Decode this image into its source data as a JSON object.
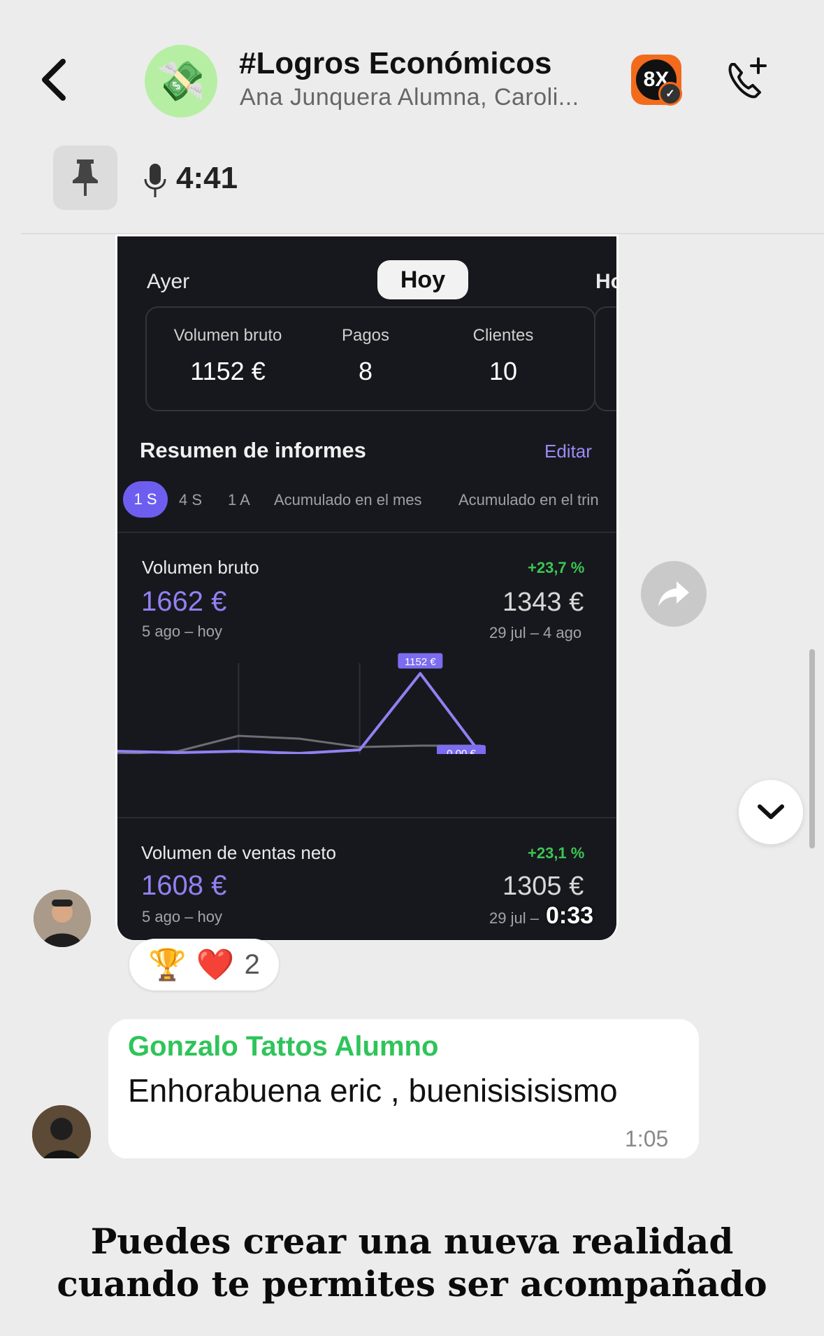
{
  "header": {
    "back_icon": "chevron-left-icon",
    "group_avatar_icon": "money-with-wings-icon",
    "title": "#Logros Económicos",
    "subtitle": "Ana Junquera Alumna, Caroli...",
    "badge_label": "8X",
    "call_icon": "phone-plus-icon"
  },
  "pinned": {
    "pin_icon": "pin-icon",
    "mic_icon": "microphone-icon",
    "duration": "4:41"
  },
  "video": {
    "segments": {
      "prev": "Ayer",
      "current": "Hoy",
      "next": "Ho"
    },
    "stats": [
      {
        "label": "Volumen bruto",
        "value": "1152 €"
      },
      {
        "label": "Pagos",
        "value": "8"
      },
      {
        "label": "Clientes",
        "value": "10"
      }
    ],
    "section_title": "Resumen de informes",
    "edit_label": "Editar",
    "periods": [
      "1 S",
      "4 S",
      "1 A",
      "Acumulado en el mes",
      "Acumulado en el trin"
    ],
    "metric1": {
      "label": "Volumen bruto",
      "pct": "+23,7 %",
      "value": "1662 €",
      "prev_value": "1343 €",
      "range": "5 ago – hoy",
      "prev_range": "29 jul – 4 ago"
    },
    "metric2": {
      "label": "Volumen de ventas neto",
      "pct": "+23,1 %",
      "value": "1608 €",
      "prev_value": "1305 €",
      "range": "5 ago – hoy",
      "prev_range": "29 jul –"
    },
    "timer": "0:33"
  },
  "chart_data": {
    "type": "line",
    "x": [
      0,
      1,
      2,
      3,
      4,
      5,
      6
    ],
    "series": [
      {
        "color": "#8e82f3",
        "values": [
          40,
          20,
          40,
          10,
          60,
          1152,
          0
        ]
      },
      {
        "color": "#6c6c72",
        "values": [
          0,
          40,
          260,
          220,
          100,
          120,
          120
        ]
      }
    ],
    "labels": {
      "peak": "1152 €",
      "end": "0,00 €"
    },
    "ylim": [
      0,
      1200
    ],
    "grid": "vertical"
  },
  "actions": {
    "forward_icon": "share-arrow-icon",
    "scroll_down_icon": "chevron-down-icon"
  },
  "reactions": {
    "emoji1": "🏆",
    "emoji2": "❤️",
    "count": "2"
  },
  "message": {
    "sender": "Gonzalo Tattos Alumno",
    "text": "Enhorabuena eric , buenisisisismo",
    "time": "1:05"
  },
  "caption": {
    "line1": "Puedes crear una nueva realidad",
    "line2": "cuando te permites ser acompañado"
  }
}
